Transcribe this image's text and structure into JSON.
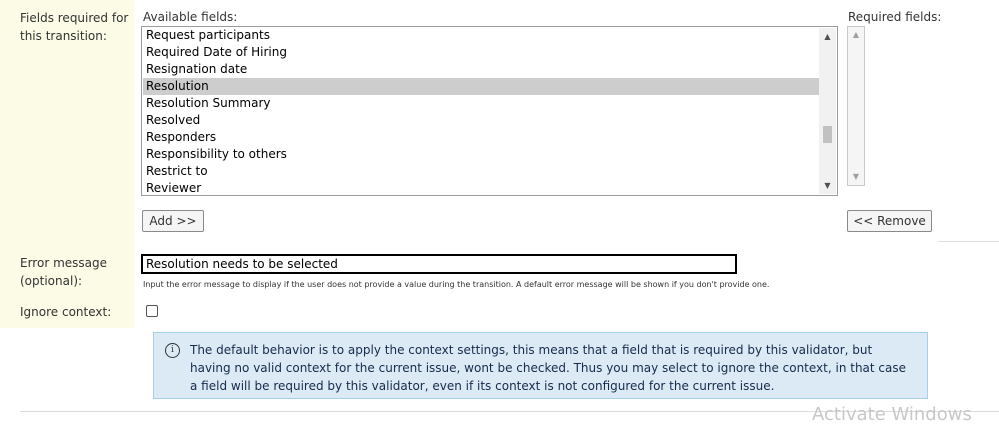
{
  "labels": {
    "fields_required": "Fields required for this transition:",
    "error_message": "Error message (optional):",
    "ignore_context": "Ignore context:"
  },
  "available": {
    "title": "Available fields:",
    "items": [
      "Request participants",
      "Required Date of Hiring",
      "Resignation date",
      "Resolution",
      "Resolution Summary",
      "Resolved",
      "Responders",
      "Responsibility to others",
      "Restrict to",
      "Reviewer"
    ],
    "selected_index": 3
  },
  "required": {
    "title": "Required fields:",
    "items": []
  },
  "buttons": {
    "add": "Add >>",
    "remove": "<< Remove"
  },
  "error": {
    "value": "Resolution needs to be selected",
    "help": "Input the error message to display if the user does not provide a value during the transition. A default error message will be shown if you don't provide one."
  },
  "ignore_context_checked": false,
  "info": {
    "text": "The default behavior is to apply the context settings, this means that a field that is required by this validator, but having no valid context for the current issue, wont be checked. Thus you may select to ignore the context, in that case a field will be required by this validator, even if its context is not configured for the current issue."
  },
  "watermark": "Activate Windows"
}
